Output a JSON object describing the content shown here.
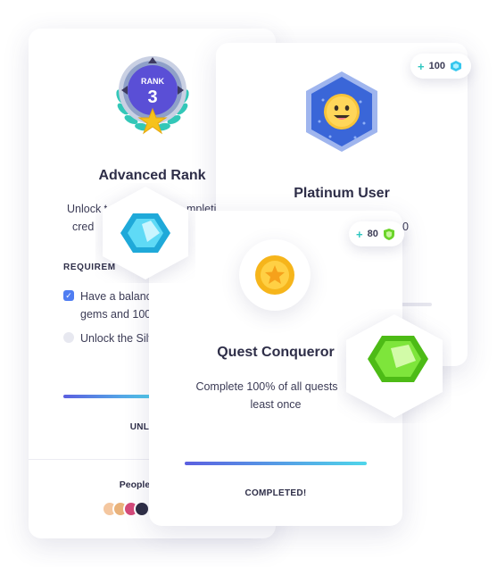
{
  "cards": {
    "advanced_rank": {
      "badge_text": "RANK",
      "badge_number": "3",
      "title": "Advanced Rank",
      "description_line1": "Unlock t",
      "description_line1b": "mpleting",
      "description_line2": "cred",
      "requirements_label": "REQUIREM",
      "requirements": [
        {
          "line1": "Have a balanc",
          "line2": "gems and 100",
          "checked": true
        },
        {
          "line1": "Unlock the Silv",
          "line2": "",
          "checked": false
        }
      ],
      "status": "UNLO",
      "progress_fraction": 0.55,
      "people_label": "People who ha"
    },
    "platinum_user": {
      "title": "Platinum User",
      "reward_amount": "100",
      "desc_fragment": "0",
      "progress_fraction": 0.3
    },
    "quest_conqueror": {
      "title": "Quest Conqueror",
      "description_line1": "Complete 100% of all quests",
      "description_line2": "least once",
      "reward_amount": "80",
      "status": "COMPLETED!",
      "progress_fraction": 1.0
    }
  },
  "colors": {
    "accent_teal": "#2ec6c0",
    "progress_start": "#5b5fe0",
    "progress_end": "#4fd6ea",
    "checkbox_blue": "#4f7df2",
    "gem_cyan": "#37c7ee",
    "gem_green": "#6bd42a",
    "coin_gold": "#f6b51b"
  },
  "icons": [
    "rank-medal-icon",
    "platinum-smiley-badge-icon",
    "gold-star-coin-icon",
    "cyan-gem-icon",
    "green-gem-icon",
    "diamond-currency-icon",
    "shield-gem-currency-icon",
    "check-icon"
  ]
}
